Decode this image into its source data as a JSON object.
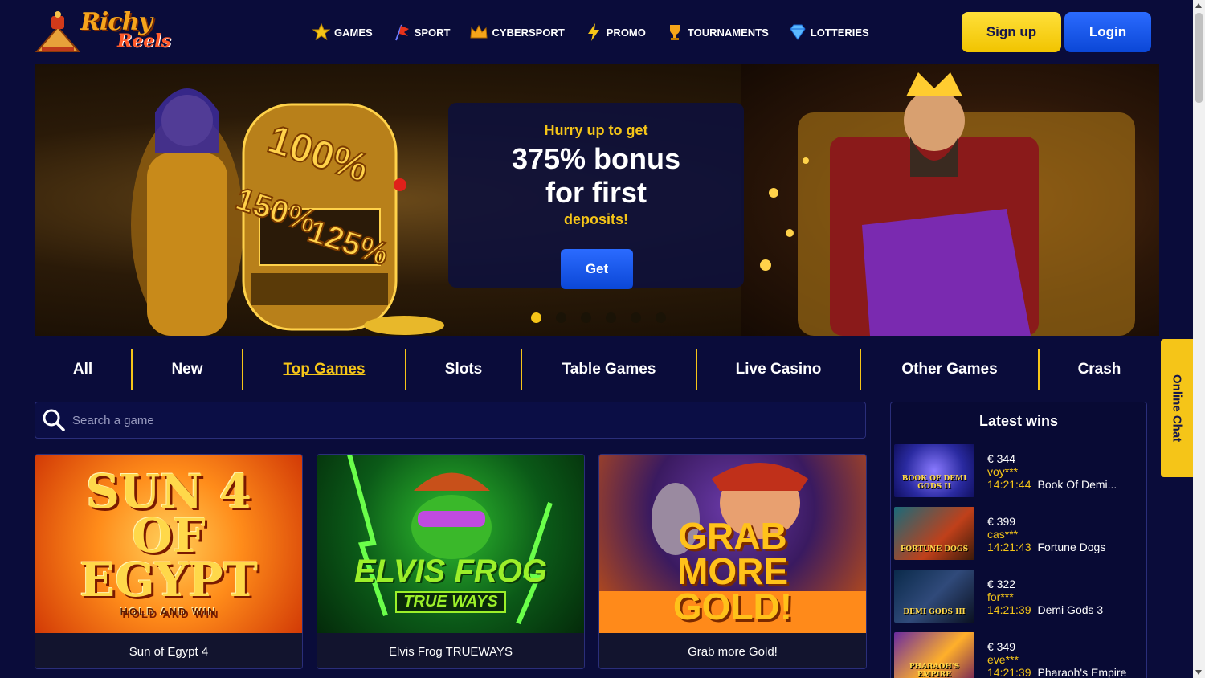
{
  "header": {
    "logo_line1": "Richy",
    "logo_line2": "Reels",
    "nav": [
      {
        "label": "GAMES",
        "icon": "star-icon"
      },
      {
        "label": "SPORT",
        "icon": "sport-flag-icon"
      },
      {
        "label": "CYBERSPORT",
        "icon": "crown-icon"
      },
      {
        "label": "PROMO",
        "icon": "lightning-icon"
      },
      {
        "label": "TOURNAMENTS",
        "icon": "trophy-icon"
      },
      {
        "label": "LOTTERIES",
        "icon": "diamond-icon"
      }
    ],
    "signup_label": "Sign up",
    "login_label": "Login"
  },
  "banner": {
    "line1": "Hurry up to get",
    "line2": "375% bonus for first",
    "line3": "deposits!",
    "button_label": "Get",
    "slot_labels": [
      "100%",
      "150%",
      "125%"
    ],
    "slides_total": 6,
    "active_slide": 1
  },
  "categories": {
    "tabs": [
      "All",
      "New",
      "Top Games",
      "Slots",
      "Table Games",
      "Live Casino",
      "Other Games",
      "Crash"
    ],
    "active": "Top Games"
  },
  "search": {
    "placeholder": "Search a game"
  },
  "games": [
    {
      "name": "Sun of Egypt 4",
      "art_title": "SUN 4 OF EGYPT",
      "art_sub": "HOLD AND WIN"
    },
    {
      "name": "Elvis Frog TRUEWAYS",
      "art_title": "ELVIS FROG",
      "art_sub": "TRUE WAYS"
    },
    {
      "name": "Grab more Gold!",
      "art_title": "GRAB MORE GOLD!",
      "art_sub": ""
    }
  ],
  "latest_wins": {
    "title": "Latest wins",
    "items": [
      {
        "amount": "€ 344",
        "user": "voy***",
        "time": "14:21:44",
        "game": "Book Of Demi...",
        "thumb_label": "BOOK OF DEMI GODS II"
      },
      {
        "amount": "€ 399",
        "user": "cas***",
        "time": "14:21:43",
        "game": "Fortune Dogs",
        "thumb_label": "FORTUNE DOGS"
      },
      {
        "amount": "€ 322",
        "user": "for***",
        "time": "14:21:39",
        "game": "Demi Gods 3",
        "thumb_label": "DEMI GODS III"
      },
      {
        "amount": "€ 349",
        "user": "eve***",
        "time": "14:21:39",
        "game": "Pharaoh's Empire",
        "thumb_label": "PHARAOH'S EMPIRE"
      }
    ]
  },
  "chat": {
    "label": "Online Chat"
  },
  "colors": {
    "background": "#0a0c3a",
    "accent_yellow": "#f5c518",
    "accent_blue": "#0b47d6"
  }
}
